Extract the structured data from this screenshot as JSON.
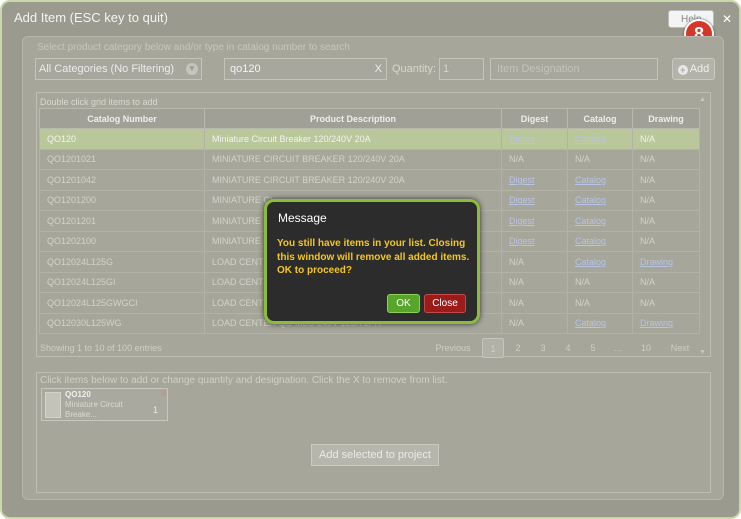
{
  "window": {
    "title": "Add Item (ESC key to quit)",
    "help_label": "Help",
    "close_glyph": "✕",
    "badge_number": "8"
  },
  "search": {
    "hint": "Select product category below and/or type in catalog number to search",
    "category_value": "All Categories (No Filtering)",
    "catalog_value": "qo120",
    "catalog_clear": "X",
    "quantity_label": "Quantity:",
    "quantity_value": "1",
    "designation_placeholder": "Item Designation",
    "add_label": "Add"
  },
  "grid": {
    "hint": "Double click grid items to add",
    "columns": [
      "Catalog Number",
      "Product Description",
      "Digest",
      "Catalog",
      "Drawing"
    ],
    "rows": [
      {
        "catalog_number": "QO120",
        "description": "Miniature Circuit Breaker 120/240V 20A",
        "digest": "Digest",
        "catalog": "Catalog",
        "drawing": "N/A"
      },
      {
        "catalog_number": "QO1201021",
        "description": "MINIATURE CIRCUIT BREAKER 120/240V 20A",
        "digest": "N/A",
        "catalog": "N/A",
        "drawing": "N/A"
      },
      {
        "catalog_number": "QO1201042",
        "description": "MINIATURE CIRCUIT BREAKER 120/240V 20A",
        "digest": "Digest",
        "catalog": "Catalog",
        "drawing": "N/A"
      },
      {
        "catalog_number": "QO1201200",
        "description": "MINIATURE CI",
        "digest": "Digest",
        "catalog": "Catalog",
        "drawing": "N/A"
      },
      {
        "catalog_number": "QO1201201",
        "description": "MINIATURE CI",
        "digest": "Digest",
        "catalog": "Catalog",
        "drawing": "N/A"
      },
      {
        "catalog_number": "QO1202100",
        "description": "MINIATURE CI",
        "digest": "Digest",
        "catalog": "Catalog",
        "drawing": "N/A"
      },
      {
        "catalog_number": "QO12024L125G",
        "description": "LOAD CENTER",
        "digest": "N/A",
        "catalog": "Catalog",
        "drawing": "Drawing"
      },
      {
        "catalog_number": "QO12024L125GI",
        "description": "LOAD CENTER",
        "digest": "N/A",
        "catalog": "N/A",
        "drawing": "N/A"
      },
      {
        "catalog_number": "QO12024L125GWGCI",
        "description": "LOAD CENTER",
        "digest": "N/A",
        "catalog": "N/A",
        "drawing": "N/A"
      },
      {
        "catalog_number": "QO12030L125WG",
        "description": "LOAD CENTER QO MLO 240V 125A 1PH",
        "digest": "N/A",
        "catalog": "Catalog",
        "drawing": "Drawing"
      }
    ],
    "entries_info": "Showing 1 to 10 of 100 entries",
    "pagination": {
      "previous": "Previous",
      "pages": [
        "1",
        "2",
        "3",
        "4",
        "5",
        "…",
        "10"
      ],
      "next": "Next",
      "active_page": "1"
    }
  },
  "list": {
    "hint": "Click items below to add or change quantity and designation. Click the X to remove from list.",
    "items": [
      {
        "part_number": "QO120",
        "desc_line1": "Miniature Circuit",
        "desc_line2": "Breake...",
        "quantity": "1",
        "remove": "X"
      }
    ],
    "add_to_project_label": "Add selected to project"
  },
  "modal": {
    "title": "Message",
    "body": "You still have items in your list. Closing this window will remove all added items. OK to proceed?",
    "ok_label": "OK",
    "close_label": "Close"
  },
  "colors": {
    "modal_border": "#8bbc3a",
    "modal_text": "#f3c624",
    "ok_button": "#57a62a",
    "close_button": "#9c1c1c",
    "selected_row": "#bac79a",
    "badge": "#d7352a"
  }
}
